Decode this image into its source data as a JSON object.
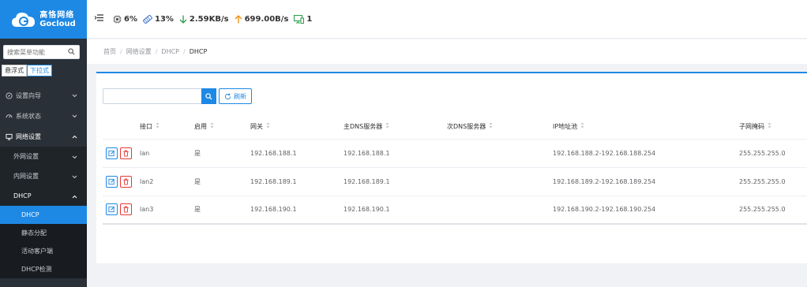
{
  "brand": {
    "name_cn": "高恪网络",
    "name_en": "Gocloud"
  },
  "sidebar": {
    "search_placeholder": "搜索菜单功能",
    "modes": [
      "悬浮式",
      "下拉式"
    ],
    "menu": [
      {
        "label": "设置向导",
        "icon": "compass-icon"
      },
      {
        "label": "系统状态",
        "icon": "gauge-icon"
      },
      {
        "label": "网络设置",
        "icon": "monitor-icon"
      }
    ],
    "network_sub": [
      {
        "label": "外网设置"
      },
      {
        "label": "内网设置"
      },
      {
        "label": "DHCP"
      }
    ],
    "dhcp_sub": [
      {
        "label": "DHCP"
      },
      {
        "label": "静态分配"
      },
      {
        "label": "活动客户端"
      },
      {
        "label": "DHCP检测"
      }
    ]
  },
  "status": {
    "cpu": "6%",
    "memory": "13%",
    "download": "2.59KB/s",
    "upload": "699.00B/s",
    "clients": "1"
  },
  "breadcrumb": [
    "首页",
    "网络设置",
    "DHCP",
    "DHCP"
  ],
  "toolbar": {
    "search_value": "",
    "refresh_label": "刷新"
  },
  "table": {
    "headers": [
      "接口",
      "启用",
      "网关",
      "主DNS服务器",
      "次DNS服务器",
      "IP地址池",
      "子网掩码"
    ],
    "rows": [
      {
        "iface": "lan",
        "enabled": "是",
        "gateway": "192.168.188.1",
        "dns1": "192.168.188.1",
        "dns2": "",
        "pool": "192.168.188.2-192.168.188.254",
        "mask": "255.255.255.0"
      },
      {
        "iface": "lan2",
        "enabled": "是",
        "gateway": "192.168.189.1",
        "dns1": "192.168.189.1",
        "dns2": "",
        "pool": "192.168.189.2-192.168.189.254",
        "mask": "255.255.255.0"
      },
      {
        "iface": "lan3",
        "enabled": "是",
        "gateway": "192.168.190.1",
        "dns1": "192.168.190.1",
        "dns2": "",
        "pool": "192.168.190.2-192.168.190.254",
        "mask": "255.255.255.0"
      }
    ]
  },
  "colors": {
    "accent": "#1e88e5",
    "sidebar_bg": "#2a3037",
    "danger": "#e53935",
    "download": "#2e9d4a",
    "upload": "#f08c00",
    "clients": "#2e9d4a"
  }
}
